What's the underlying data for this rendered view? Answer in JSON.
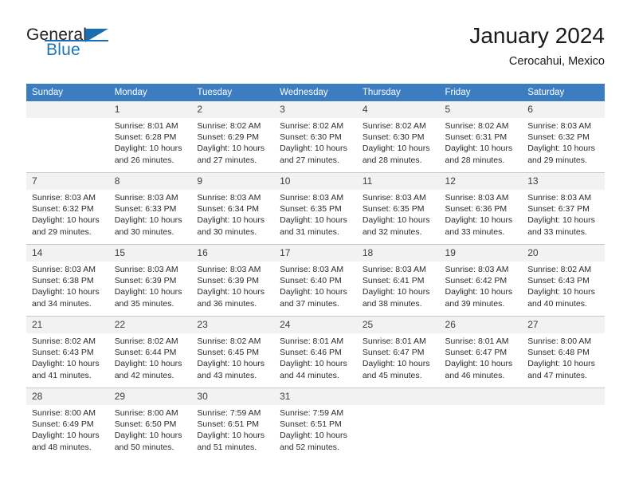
{
  "brand": {
    "name_part1": "General",
    "name_part2": "Blue",
    "logo_icon": "triangle-flag-icon",
    "accent_color": "#1b6cb0"
  },
  "header": {
    "month_title": "January 2024",
    "location": "Cerocahui, Mexico"
  },
  "calendar": {
    "header_bg": "#3b7dc0",
    "daynum_bg": "#f2f2f2",
    "weekdays": [
      "Sunday",
      "Monday",
      "Tuesday",
      "Wednesday",
      "Thursday",
      "Friday",
      "Saturday"
    ],
    "weeks": [
      [
        {
          "day": "",
          "sunrise": "",
          "sunset": "",
          "daylight_line1": "",
          "daylight_line2": ""
        },
        {
          "day": "1",
          "sunrise": "Sunrise: 8:01 AM",
          "sunset": "Sunset: 6:28 PM",
          "daylight_line1": "Daylight: 10 hours",
          "daylight_line2": "and 26 minutes."
        },
        {
          "day": "2",
          "sunrise": "Sunrise: 8:02 AM",
          "sunset": "Sunset: 6:29 PM",
          "daylight_line1": "Daylight: 10 hours",
          "daylight_line2": "and 27 minutes."
        },
        {
          "day": "3",
          "sunrise": "Sunrise: 8:02 AM",
          "sunset": "Sunset: 6:30 PM",
          "daylight_line1": "Daylight: 10 hours",
          "daylight_line2": "and 27 minutes."
        },
        {
          "day": "4",
          "sunrise": "Sunrise: 8:02 AM",
          "sunset": "Sunset: 6:30 PM",
          "daylight_line1": "Daylight: 10 hours",
          "daylight_line2": "and 28 minutes."
        },
        {
          "day": "5",
          "sunrise": "Sunrise: 8:02 AM",
          "sunset": "Sunset: 6:31 PM",
          "daylight_line1": "Daylight: 10 hours",
          "daylight_line2": "and 28 minutes."
        },
        {
          "day": "6",
          "sunrise": "Sunrise: 8:03 AM",
          "sunset": "Sunset: 6:32 PM",
          "daylight_line1": "Daylight: 10 hours",
          "daylight_line2": "and 29 minutes."
        }
      ],
      [
        {
          "day": "7",
          "sunrise": "Sunrise: 8:03 AM",
          "sunset": "Sunset: 6:32 PM",
          "daylight_line1": "Daylight: 10 hours",
          "daylight_line2": "and 29 minutes."
        },
        {
          "day": "8",
          "sunrise": "Sunrise: 8:03 AM",
          "sunset": "Sunset: 6:33 PM",
          "daylight_line1": "Daylight: 10 hours",
          "daylight_line2": "and 30 minutes."
        },
        {
          "day": "9",
          "sunrise": "Sunrise: 8:03 AM",
          "sunset": "Sunset: 6:34 PM",
          "daylight_line1": "Daylight: 10 hours",
          "daylight_line2": "and 30 minutes."
        },
        {
          "day": "10",
          "sunrise": "Sunrise: 8:03 AM",
          "sunset": "Sunset: 6:35 PM",
          "daylight_line1": "Daylight: 10 hours",
          "daylight_line2": "and 31 minutes."
        },
        {
          "day": "11",
          "sunrise": "Sunrise: 8:03 AM",
          "sunset": "Sunset: 6:35 PM",
          "daylight_line1": "Daylight: 10 hours",
          "daylight_line2": "and 32 minutes."
        },
        {
          "day": "12",
          "sunrise": "Sunrise: 8:03 AM",
          "sunset": "Sunset: 6:36 PM",
          "daylight_line1": "Daylight: 10 hours",
          "daylight_line2": "and 33 minutes."
        },
        {
          "day": "13",
          "sunrise": "Sunrise: 8:03 AM",
          "sunset": "Sunset: 6:37 PM",
          "daylight_line1": "Daylight: 10 hours",
          "daylight_line2": "and 33 minutes."
        }
      ],
      [
        {
          "day": "14",
          "sunrise": "Sunrise: 8:03 AM",
          "sunset": "Sunset: 6:38 PM",
          "daylight_line1": "Daylight: 10 hours",
          "daylight_line2": "and 34 minutes."
        },
        {
          "day": "15",
          "sunrise": "Sunrise: 8:03 AM",
          "sunset": "Sunset: 6:39 PM",
          "daylight_line1": "Daylight: 10 hours",
          "daylight_line2": "and 35 minutes."
        },
        {
          "day": "16",
          "sunrise": "Sunrise: 8:03 AM",
          "sunset": "Sunset: 6:39 PM",
          "daylight_line1": "Daylight: 10 hours",
          "daylight_line2": "and 36 minutes."
        },
        {
          "day": "17",
          "sunrise": "Sunrise: 8:03 AM",
          "sunset": "Sunset: 6:40 PM",
          "daylight_line1": "Daylight: 10 hours",
          "daylight_line2": "and 37 minutes."
        },
        {
          "day": "18",
          "sunrise": "Sunrise: 8:03 AM",
          "sunset": "Sunset: 6:41 PM",
          "daylight_line1": "Daylight: 10 hours",
          "daylight_line2": "and 38 minutes."
        },
        {
          "day": "19",
          "sunrise": "Sunrise: 8:03 AM",
          "sunset": "Sunset: 6:42 PM",
          "daylight_line1": "Daylight: 10 hours",
          "daylight_line2": "and 39 minutes."
        },
        {
          "day": "20",
          "sunrise": "Sunrise: 8:02 AM",
          "sunset": "Sunset: 6:43 PM",
          "daylight_line1": "Daylight: 10 hours",
          "daylight_line2": "and 40 minutes."
        }
      ],
      [
        {
          "day": "21",
          "sunrise": "Sunrise: 8:02 AM",
          "sunset": "Sunset: 6:43 PM",
          "daylight_line1": "Daylight: 10 hours",
          "daylight_line2": "and 41 minutes."
        },
        {
          "day": "22",
          "sunrise": "Sunrise: 8:02 AM",
          "sunset": "Sunset: 6:44 PM",
          "daylight_line1": "Daylight: 10 hours",
          "daylight_line2": "and 42 minutes."
        },
        {
          "day": "23",
          "sunrise": "Sunrise: 8:02 AM",
          "sunset": "Sunset: 6:45 PM",
          "daylight_line1": "Daylight: 10 hours",
          "daylight_line2": "and 43 minutes."
        },
        {
          "day": "24",
          "sunrise": "Sunrise: 8:01 AM",
          "sunset": "Sunset: 6:46 PM",
          "daylight_line1": "Daylight: 10 hours",
          "daylight_line2": "and 44 minutes."
        },
        {
          "day": "25",
          "sunrise": "Sunrise: 8:01 AM",
          "sunset": "Sunset: 6:47 PM",
          "daylight_line1": "Daylight: 10 hours",
          "daylight_line2": "and 45 minutes."
        },
        {
          "day": "26",
          "sunrise": "Sunrise: 8:01 AM",
          "sunset": "Sunset: 6:47 PM",
          "daylight_line1": "Daylight: 10 hours",
          "daylight_line2": "and 46 minutes."
        },
        {
          "day": "27",
          "sunrise": "Sunrise: 8:00 AM",
          "sunset": "Sunset: 6:48 PM",
          "daylight_line1": "Daylight: 10 hours",
          "daylight_line2": "and 47 minutes."
        }
      ],
      [
        {
          "day": "28",
          "sunrise": "Sunrise: 8:00 AM",
          "sunset": "Sunset: 6:49 PM",
          "daylight_line1": "Daylight: 10 hours",
          "daylight_line2": "and 48 minutes."
        },
        {
          "day": "29",
          "sunrise": "Sunrise: 8:00 AM",
          "sunset": "Sunset: 6:50 PM",
          "daylight_line1": "Daylight: 10 hours",
          "daylight_line2": "and 50 minutes."
        },
        {
          "day": "30",
          "sunrise": "Sunrise: 7:59 AM",
          "sunset": "Sunset: 6:51 PM",
          "daylight_line1": "Daylight: 10 hours",
          "daylight_line2": "and 51 minutes."
        },
        {
          "day": "31",
          "sunrise": "Sunrise: 7:59 AM",
          "sunset": "Sunset: 6:51 PM",
          "daylight_line1": "Daylight: 10 hours",
          "daylight_line2": "and 52 minutes."
        },
        {
          "day": "",
          "sunrise": "",
          "sunset": "",
          "daylight_line1": "",
          "daylight_line2": ""
        },
        {
          "day": "",
          "sunrise": "",
          "sunset": "",
          "daylight_line1": "",
          "daylight_line2": ""
        },
        {
          "day": "",
          "sunrise": "",
          "sunset": "",
          "daylight_line1": "",
          "daylight_line2": ""
        }
      ]
    ]
  }
}
